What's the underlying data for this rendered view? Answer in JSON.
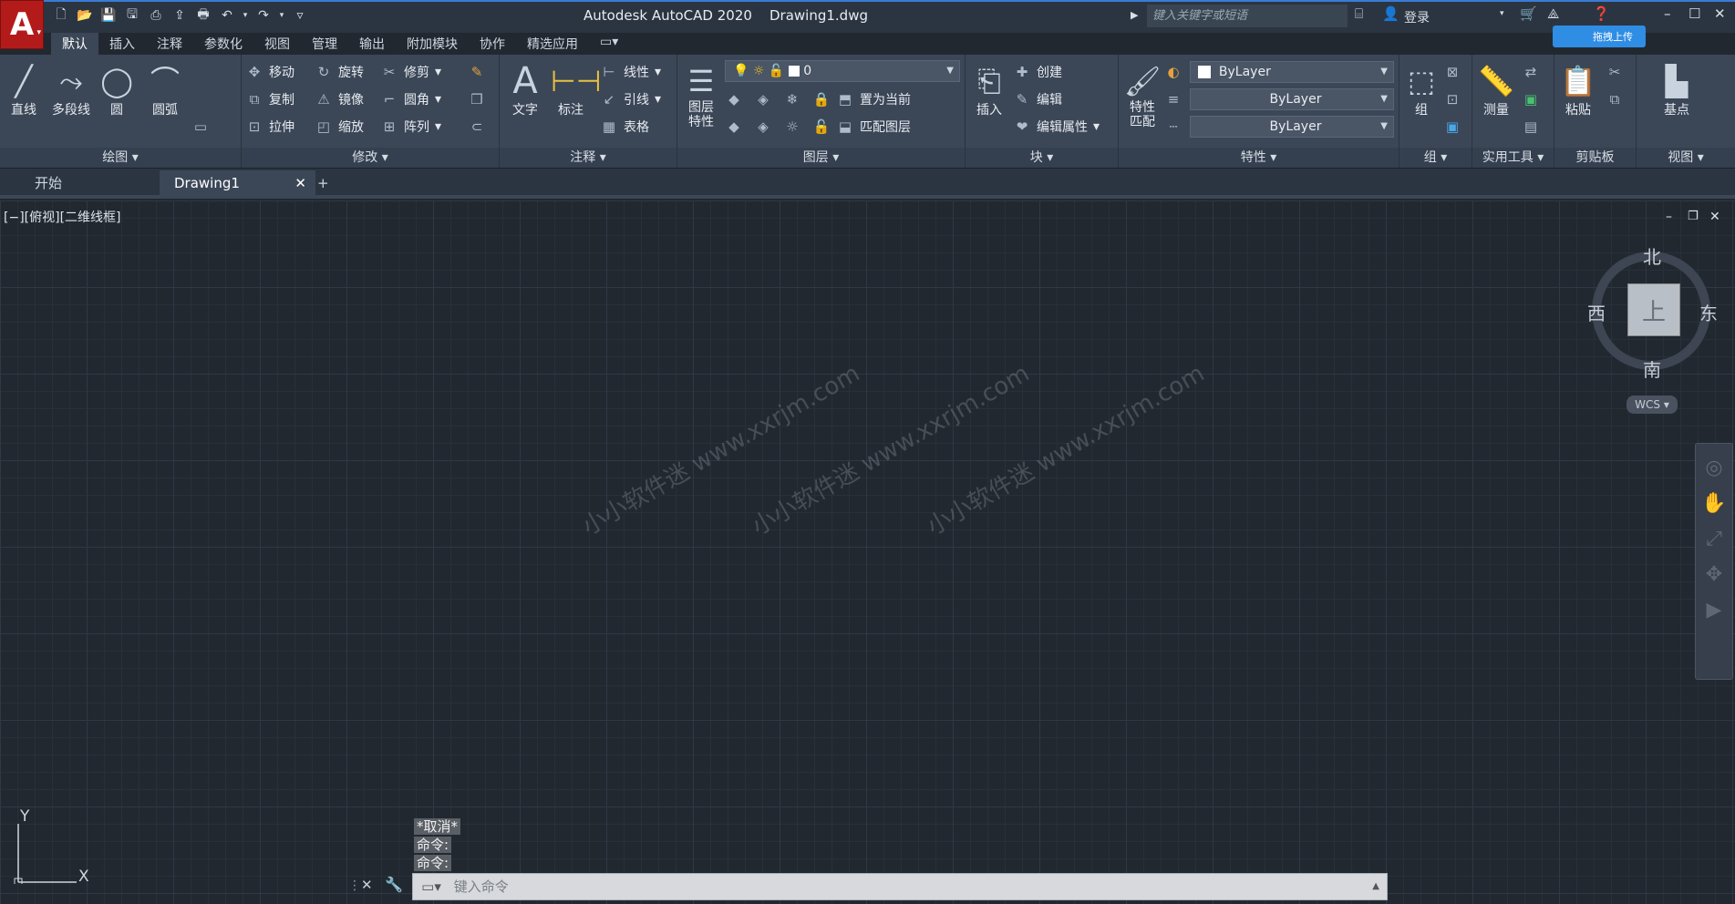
{
  "title": {
    "app": "Autodesk AutoCAD 2020",
    "doc": "Drawing1.dwg"
  },
  "search": {
    "placeholder": "键入关键字或短语"
  },
  "login": "登录",
  "upload": "拖拽上传",
  "tabs": [
    "默认",
    "插入",
    "注释",
    "参数化",
    "视图",
    "管理",
    "输出",
    "附加模块",
    "协作",
    "精选应用"
  ],
  "panels": {
    "draw": {
      "label": "绘图",
      "line": "直线",
      "polyline": "多段线",
      "circle": "圆",
      "arc": "圆弧"
    },
    "modify": {
      "label": "修改",
      "move": "移动",
      "rotate": "旋转",
      "trim": "修剪",
      "copy": "复制",
      "mirror": "镜像",
      "fillet": "圆角",
      "stretch": "拉伸",
      "scale": "缩放",
      "array": "阵列"
    },
    "annotation": {
      "label": "注释",
      "text": "文字",
      "dimension": "标注",
      "linear": "线性",
      "leader": "引线",
      "table": "表格"
    },
    "layers": {
      "label": "图层",
      "props": "图层\n特性",
      "layer_value": "0",
      "set_current": "置为当前",
      "match": "匹配图层"
    },
    "block": {
      "label": "块",
      "insert": "插入",
      "create": "创建",
      "edit": "编辑",
      "edit_attr": "编辑属性"
    },
    "properties": {
      "label": "特性",
      "match": "特性\n匹配",
      "color": "ByLayer",
      "linetype": "ByLayer",
      "lineweight": "ByLayer"
    },
    "groups": {
      "label": "组",
      "group": "组"
    },
    "utilities": {
      "label": "实用工具",
      "measure": "测量"
    },
    "clipboard": {
      "label": "剪贴板",
      "paste": "粘贴"
    },
    "view": {
      "label": "视图",
      "base": "基点"
    }
  },
  "doctabs": {
    "start": "开始",
    "drawing": "Drawing1"
  },
  "viewport_label": "[−][俯视][二维线框]",
  "watermark": "小小软件迷 www.xxrjm.com",
  "viewcube": {
    "north": "北",
    "south": "南",
    "east": "东",
    "west": "西",
    "top": "上",
    "wcs": "WCS"
  },
  "command": {
    "history": [
      "*取消*",
      "命令:",
      "命令:"
    ],
    "placeholder": "键入命令"
  },
  "ucs": {
    "x": "X",
    "y": "Y"
  }
}
